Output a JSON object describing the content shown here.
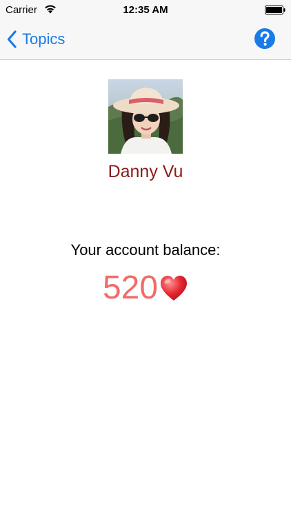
{
  "status_bar": {
    "carrier": "Carrier",
    "time": "12:35 AM"
  },
  "nav": {
    "back_label": "Topics",
    "back_icon": "chevron-left-icon",
    "help_icon": "question-circle-icon",
    "accent_color": "#1a7ae8"
  },
  "profile": {
    "name": "Danny Vu",
    "name_color": "#8b1a1a"
  },
  "account": {
    "balance_label": "Your account balance:",
    "balance_value": "520",
    "balance_color": "#f26b6b",
    "currency_icon": "heart-icon"
  }
}
